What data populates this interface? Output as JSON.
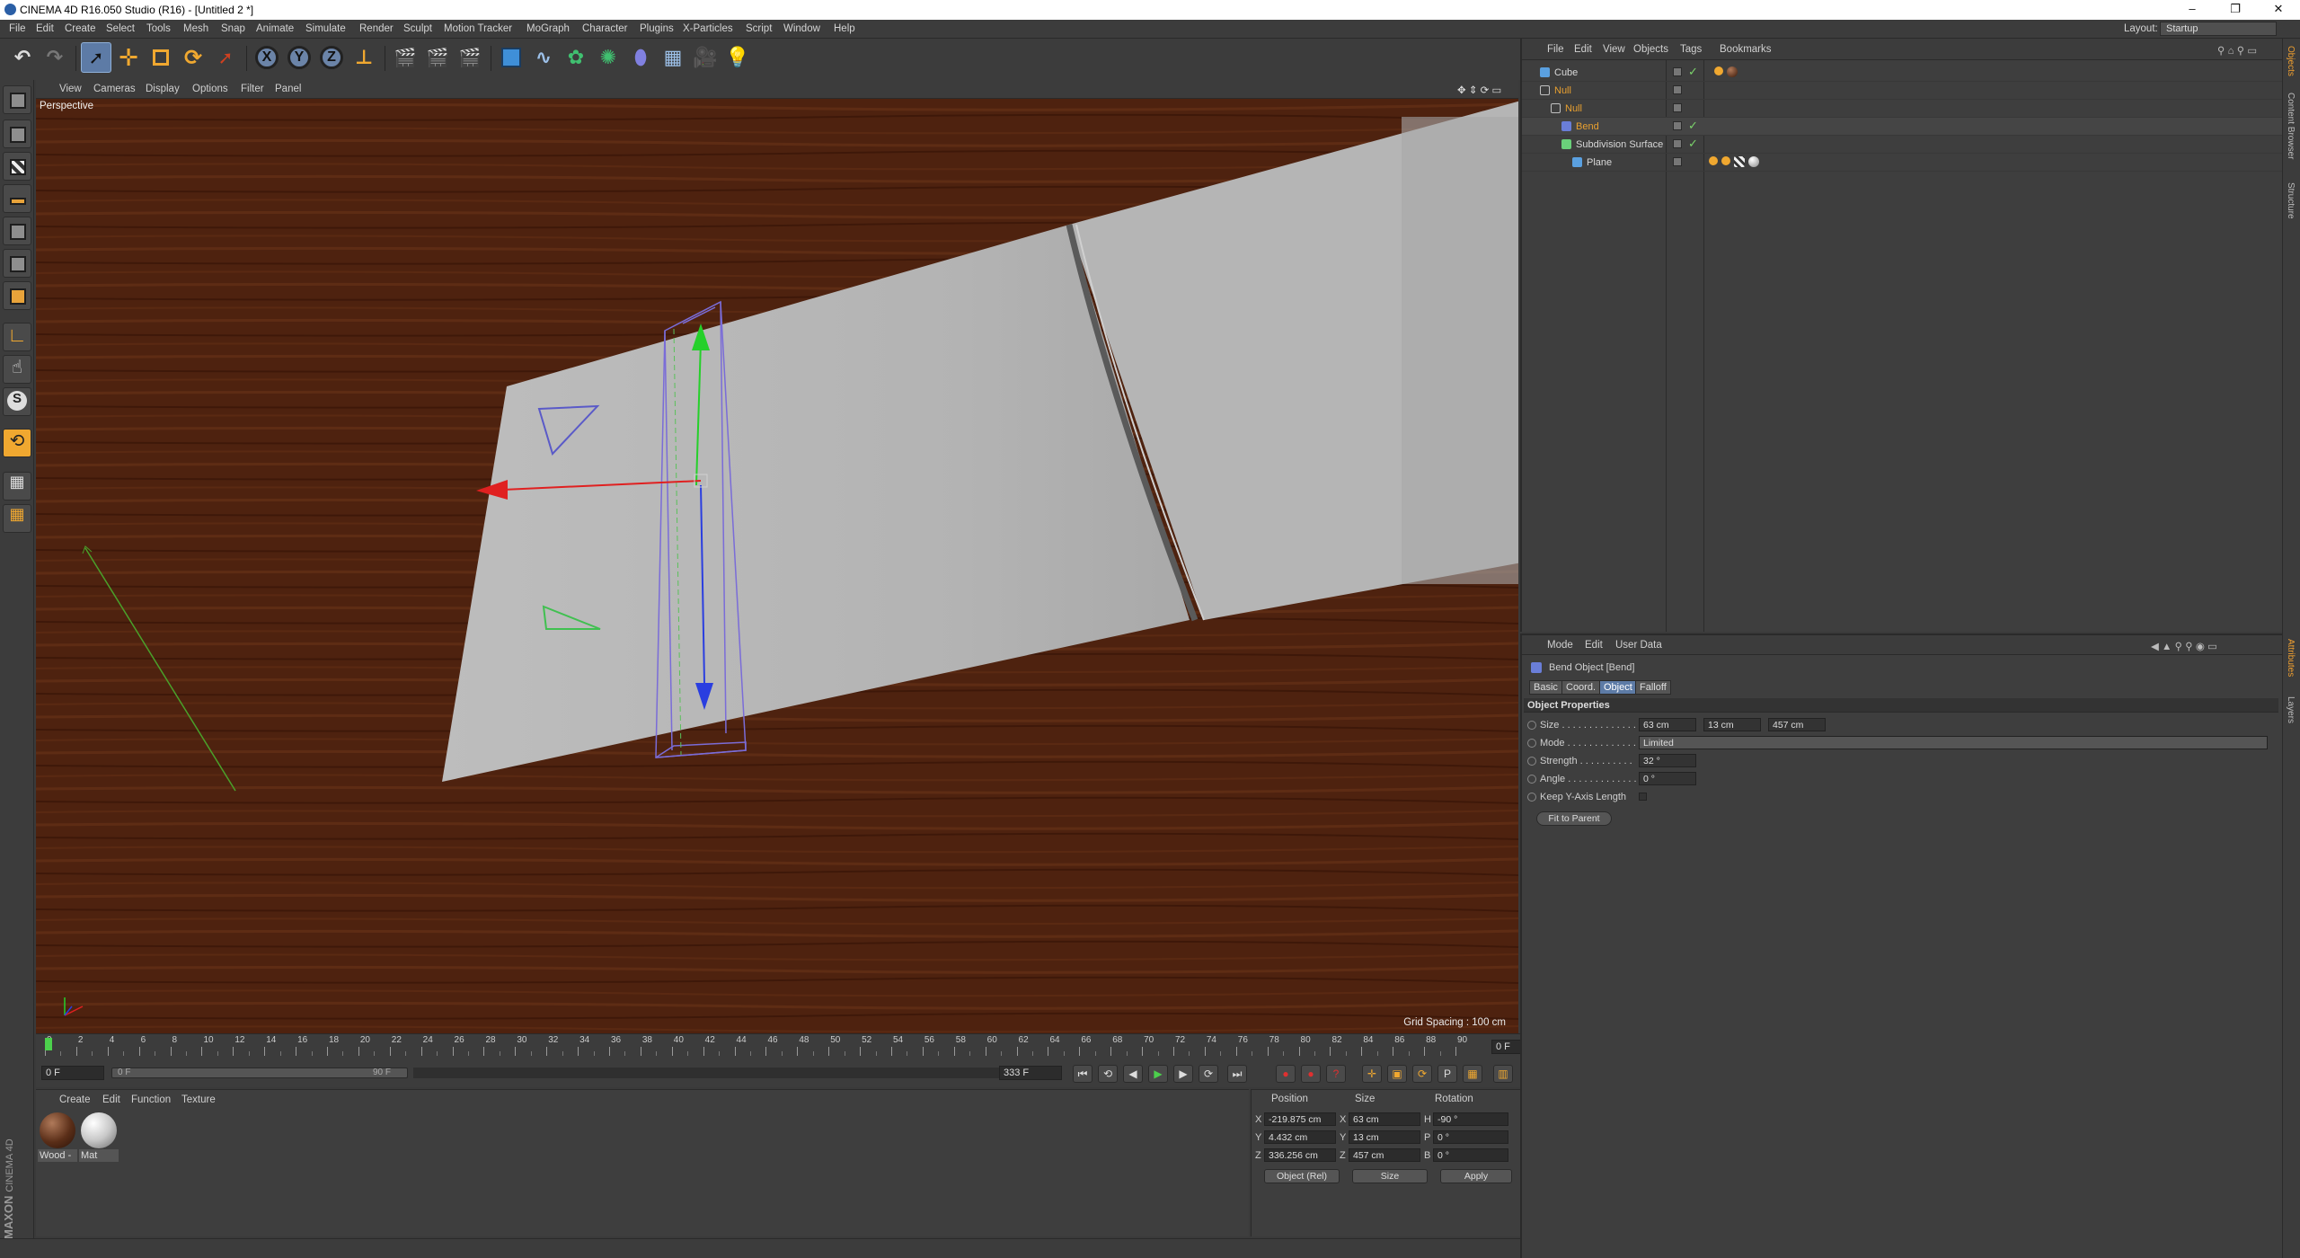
{
  "window": {
    "title": "CINEMA 4D R16.050 Studio (R16) - [Untitled 2 *]",
    "minimize": "–",
    "restore": "❐",
    "close": "✕"
  },
  "menubar": {
    "items": [
      "File",
      "Edit",
      "Create",
      "Select",
      "Tools",
      "Mesh",
      "Snap",
      "Animate",
      "Simulate",
      "Render",
      "Sculpt",
      "Motion Tracker",
      "MoGraph",
      "Character",
      "Plugins",
      "X-Particles",
      "Script",
      "Window",
      "Help"
    ],
    "layout_label": "Layout:",
    "layout_value": "Startup"
  },
  "toolbar": {
    "undo_icon": "undo-icon",
    "axis_x": "X",
    "axis_y": "Y",
    "axis_z": "Z"
  },
  "viewport": {
    "menus": [
      "View",
      "Cameras",
      "Display",
      "Options",
      "Filter",
      "Panel"
    ],
    "camera_label": "Perspective",
    "grid_spacing": "Grid Spacing : 100 cm",
    "colors": {
      "wood": "#4e220f",
      "plane": "#b8b8b8",
      "x_axis": "#e02020",
      "y_axis": "#25d02a",
      "z_axis": "#2a3ee0",
      "deformer": "#7a6cd8"
    }
  },
  "timeline": {
    "ticks": [
      "0",
      "2",
      "4",
      "6",
      "8",
      "10",
      "12",
      "14",
      "16",
      "18",
      "20",
      "22",
      "24",
      "26",
      "28",
      "30",
      "32",
      "34",
      "36",
      "38",
      "40",
      "42",
      "44",
      "46",
      "48",
      "50",
      "52",
      "54",
      "56",
      "58",
      "60",
      "62",
      "64",
      "66",
      "68",
      "70",
      "72",
      "74",
      "76",
      "78",
      "80",
      "82",
      "84",
      "86",
      "88",
      "90"
    ],
    "current_frame": "0 F",
    "start_frame": "0 F",
    "range_start": "0 F",
    "range_end": "90 F",
    "end_frame": "333 F"
  },
  "material_manager": {
    "menus": [
      "Create",
      "Edit",
      "Function",
      "Texture"
    ],
    "materials": [
      {
        "label": "Wood -",
        "color": "#5a2e18"
      },
      {
        "label": "Mat",
        "color": "#c8c8c8"
      }
    ]
  },
  "coordinates": {
    "headers": {
      "position": "Position",
      "size": "Size",
      "rotation": "Rotation"
    },
    "rows": [
      {
        "axis": "X",
        "pos": "-219.875 cm",
        "size_axis": "X",
        "size": "63 cm",
        "rot_axis": "H",
        "rot": "-90 °"
      },
      {
        "axis": "Y",
        "pos": "4.432 cm",
        "size_axis": "Y",
        "size": "13 cm",
        "rot_axis": "P",
        "rot": "0 °"
      },
      {
        "axis": "Z",
        "pos": "336.256 cm",
        "size_axis": "Z",
        "size": "457 cm",
        "rot_axis": "B",
        "rot": "0 °"
      }
    ],
    "mode_select": "Object (Rel)",
    "size_select": "Size",
    "apply": "Apply"
  },
  "object_manager": {
    "menus": [
      "File",
      "Edit",
      "View",
      "Objects",
      "Tags",
      "Bookmarks"
    ],
    "objects": [
      {
        "name": "Cube",
        "indent": 0,
        "color": "#d8d8d8",
        "icon_color": "#5aa0e0",
        "selected": false
      },
      {
        "name": "Null",
        "indent": 0,
        "color": "#e8a030",
        "icon_color": "#c0c0c0",
        "selected": false
      },
      {
        "name": "Null",
        "indent": 1,
        "color": "#e8a030",
        "icon_color": "#c0c0c0",
        "selected": false
      },
      {
        "name": "Bend",
        "indent": 2,
        "color": "#e8a030",
        "icon_color": "#6a7ed8",
        "selected": true
      },
      {
        "name": "Subdivision Surface",
        "indent": 2,
        "color": "#d8d8d8",
        "icon_color": "#6ad07a",
        "selected": false
      },
      {
        "name": "Plane",
        "indent": 3,
        "color": "#d8d8d8",
        "icon_color": "#5aa0e0",
        "selected": false
      }
    ]
  },
  "attribute_manager": {
    "menus": [
      "Mode",
      "Edit",
      "User Data"
    ],
    "title": "Bend Object [Bend]",
    "tabs": [
      "Basic",
      "Coord.",
      "Object",
      "Falloff"
    ],
    "active_tab": "Object",
    "section": "Object Properties",
    "size_label": "Size . . . . . . . . . . . . . .",
    "size_x": "63 cm",
    "size_y": "13 cm",
    "size_z": "457 cm",
    "mode_label": "Mode . . . . . . . . . . . . . .",
    "mode_value": "Limited",
    "strength_label": "Strength . . . . . . . . . .",
    "strength_value": "32 °",
    "angle_label": "Angle . . . . . . . . . . . . .",
    "angle_value": "0 °",
    "keep_y_label": "Keep Y-Axis Length",
    "fit_to_parent": "Fit to Parent"
  },
  "right_tabs": [
    "Objects",
    "Content Browser",
    "Structure"
  ],
  "right_tabs_lower": [
    "Attributes",
    "Layers"
  ],
  "logo": {
    "brand": "MAXON",
    "product": "CINEMA 4D"
  }
}
